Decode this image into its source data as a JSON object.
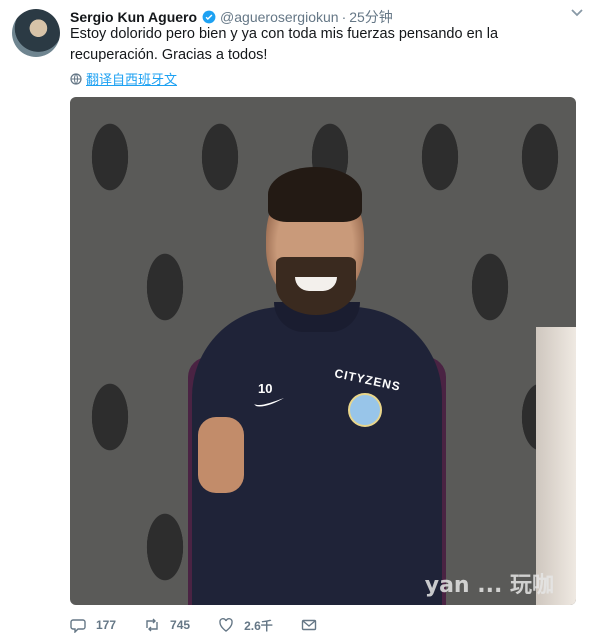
{
  "tweet": {
    "display_name": "Sergio Kun Aguero",
    "handle": "@aguerosergiokun",
    "separator": "·",
    "time": "25分钟",
    "text": "Estoy dolorido pero bien y ya con toda mis fuerzas pensando en la recuperación. Gracias a todos!",
    "translate_label": "翻译自西班牙文",
    "verified_icon": "verified-badge-icon",
    "accent_color": "#1da1f2"
  },
  "media": {
    "jersey_number": "10",
    "jersey_sponsor": "CITYZENS",
    "watermark": "yan ... 玩咖"
  },
  "actions": {
    "reply_count": "177",
    "retweet_count": "745",
    "like_count": "2.6千",
    "icons": [
      "reply-icon",
      "retweet-icon",
      "like-icon",
      "message-icon"
    ]
  }
}
